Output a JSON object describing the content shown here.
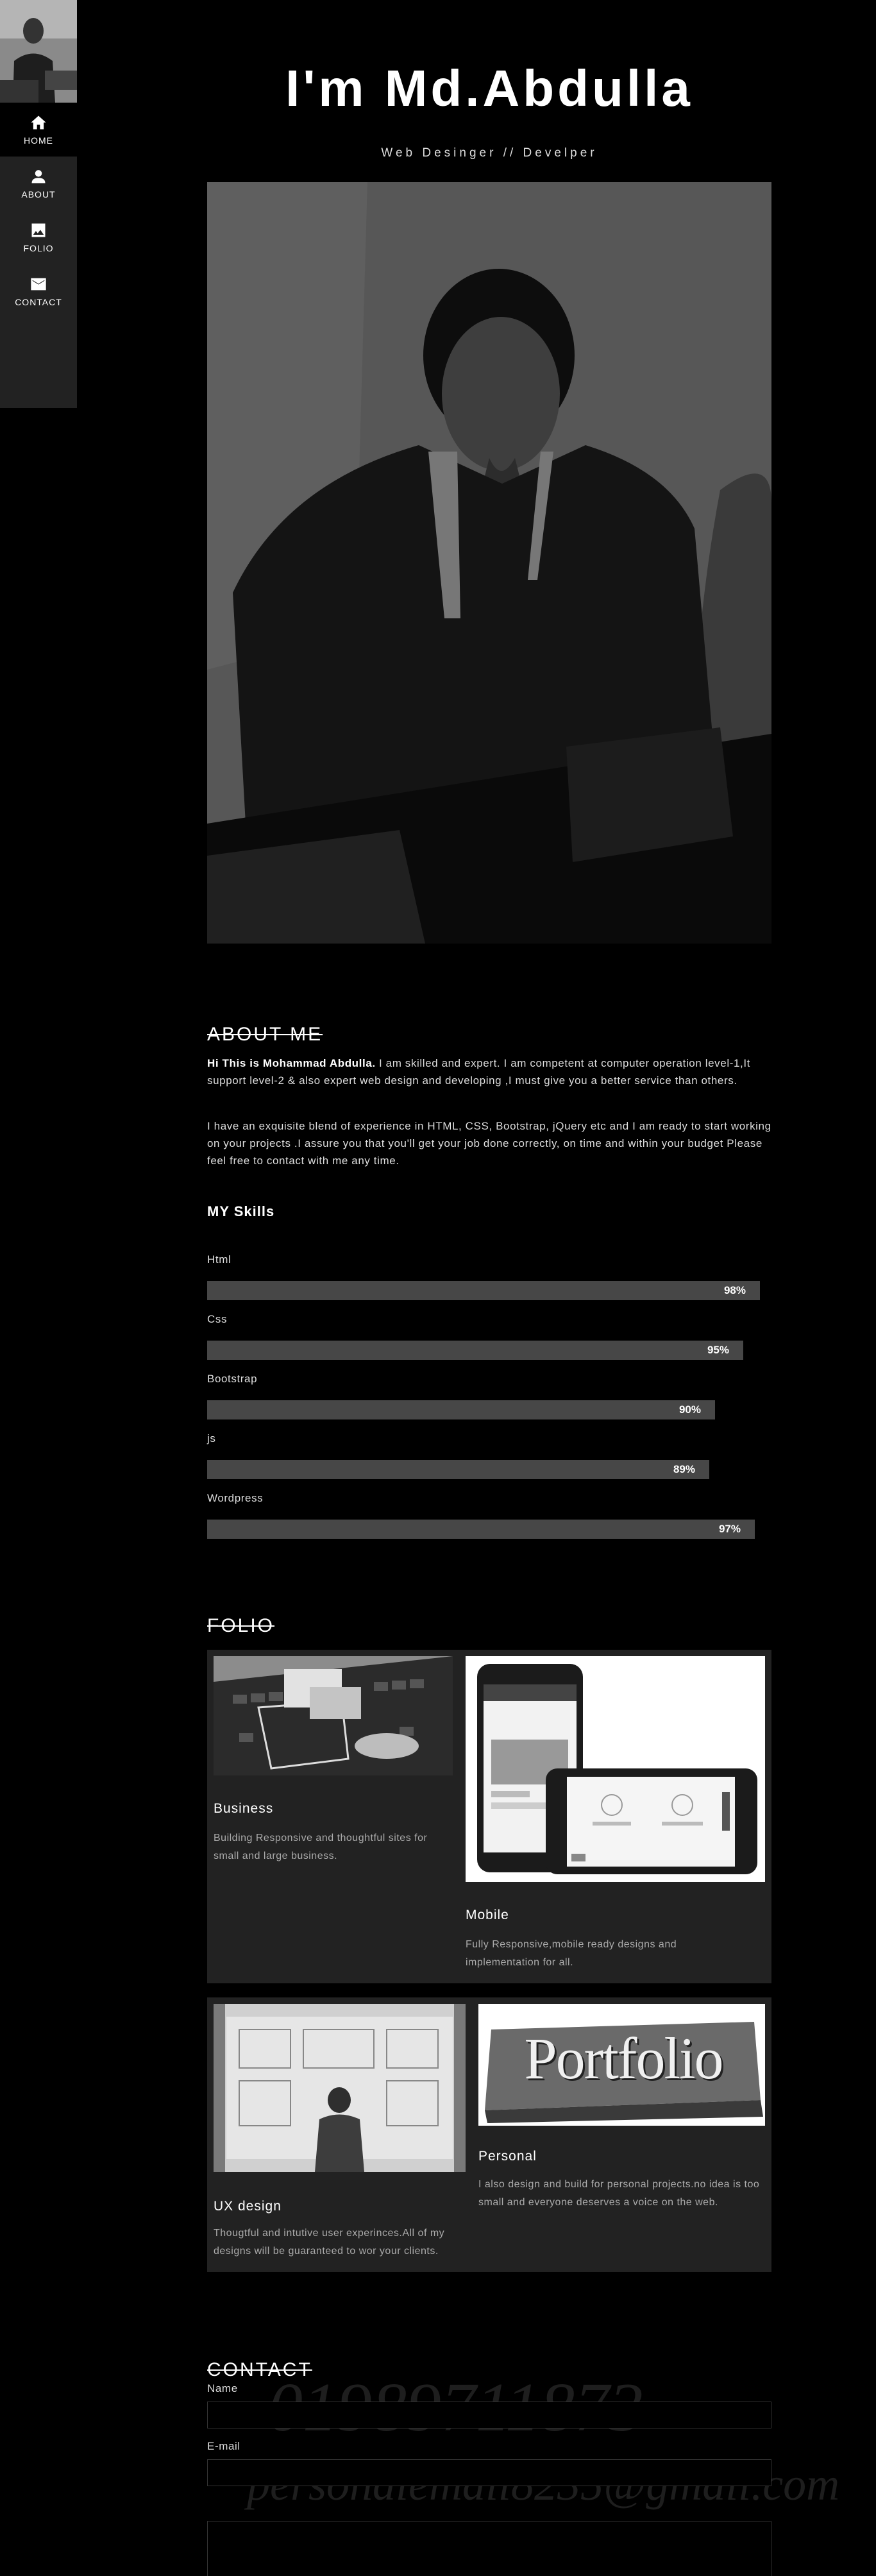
{
  "sidebar": {
    "nav": [
      {
        "label": "HOME",
        "icon": "home-icon"
      },
      {
        "label": "ABOUT",
        "icon": "person-icon"
      },
      {
        "label": "FOLIO",
        "icon": "image-icon"
      },
      {
        "label": "CONTACT",
        "icon": "mail-icon"
      }
    ]
  },
  "hero": {
    "title": "I'm Md.Abdulla",
    "subtitle": "Web Desinger // Develper"
  },
  "about": {
    "heading": "ABOUT ME",
    "intro_bold": "Hi This is Mohammad Abdulla.",
    "intro_rest": " I am skilled and expert. I am competent at computer operation level-1,It support level-2 & also expert web design and developing ,I must give you a better service than others.",
    "para2": "I have an exquisite blend of experience in HTML, CSS, Bootstrap, jQuery etc and I am ready to start working on your projects .I assure you that you'll get your job done correctly, on time and within your budget Please feel free to contact with me any time.",
    "skills_title": "MY Skills",
    "skills": [
      {
        "name": "Html",
        "percent": "98%",
        "value": 0.98
      },
      {
        "name": "Css",
        "percent": "95%",
        "value": 0.95
      },
      {
        "name": "Bootstrap",
        "percent": "90%",
        "value": 0.9
      },
      {
        "name": "js",
        "percent": "89%",
        "value": 0.89
      },
      {
        "name": "Wordpress",
        "percent": "97%",
        "value": 0.97
      }
    ]
  },
  "folio": {
    "heading": "FOLIO",
    "cards": [
      {
        "title": "Business",
        "text": "Building Responsive and thoughtful sites for small and large business."
      },
      {
        "title": "Mobile",
        "text": "Fully Responsive,mobile ready designs and implementation for all."
      },
      {
        "title": "UX design",
        "text": "Thougtful and intutive user experinces.All of my designs will be guaranteed to wor your clients."
      },
      {
        "title": "Personal",
        "text": "I also design and build for personal projects.no idea is too small and everyone deserves a voice on the web."
      }
    ],
    "portfolio_word": "Portfolio"
  },
  "contact": {
    "heading": "CONTACT",
    "name_label": "Name",
    "email_label": "E-mail",
    "phone_watermark": "01989711873",
    "email_watermark": "personalemail8235@gmail.com"
  }
}
